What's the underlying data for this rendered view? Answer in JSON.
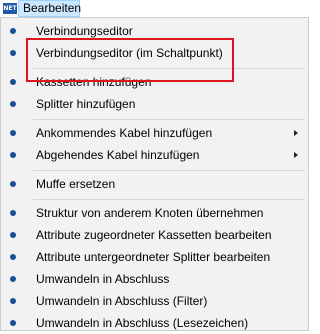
{
  "menubar": {
    "app_icon_text": "NET",
    "menu_title": "Bearbeiten"
  },
  "menu": {
    "items": [
      {
        "label": "Verbindungseditor",
        "submenu": false
      },
      {
        "label": "Verbindungseditor (im Schaltpunkt)",
        "submenu": false
      },
      {
        "label": "Kassetten hinzufügen",
        "submenu": false
      },
      {
        "label": "Splitter hinzufügen",
        "submenu": false
      },
      {
        "label": "Ankommendes Kabel hinzufügen",
        "submenu": true
      },
      {
        "label": "Abgehendes Kabel hinzufügen",
        "submenu": true
      },
      {
        "label": "Muffe ersetzen",
        "submenu": false
      },
      {
        "label": "Struktur von anderem Knoten übernehmen",
        "submenu": false
      },
      {
        "label": "Attribute zugeordneter Kassetten bearbeiten",
        "submenu": false
      },
      {
        "label": "Attribute untergeordneter Splitter bearbeiten",
        "submenu": false
      },
      {
        "label": "Umwandeln in Abschluss",
        "submenu": false
      },
      {
        "label": "Umwandeln in Abschluss (Filter)",
        "submenu": false
      },
      {
        "label": "Umwandeln in Abschluss (Lesezeichen)",
        "submenu": false
      }
    ]
  },
  "colors": {
    "highlight_border": "#e0141e",
    "bullet": "#1a4f94",
    "menu_title_selected": "#cce8ff"
  }
}
